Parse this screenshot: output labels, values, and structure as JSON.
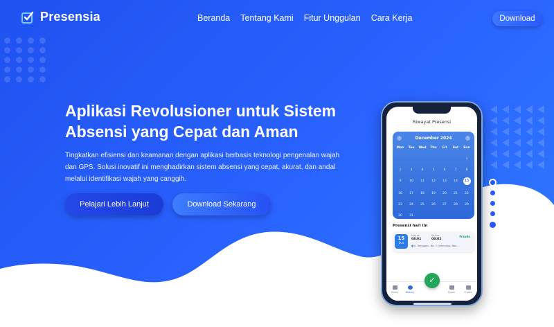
{
  "nav": {
    "logo_text": "Presensia",
    "items": [
      {
        "label": "Beranda"
      },
      {
        "label": "Tentang Kami"
      },
      {
        "label": "Fitur Unggulan"
      },
      {
        "label": "Cara Kerja"
      }
    ],
    "download_label": "Download"
  },
  "hero": {
    "title_line1": "Aplikasi Revolusioner untuk Sistem",
    "title_line2": "Absensi yang Cepat dan Aman",
    "description": "Tingkatkan efisiensi dan keamanan dengan aplikasi berbasis teknologi pengenalan wajah dan GPS. Solusi inovatif ini menghadirkan sistem absensi yang cepat, akurat, dan andal melalui identifikasi wajah yang canggih.",
    "btn_learn": "Pelajari Lebih Lanjut",
    "btn_download": "Download Sekarang"
  },
  "phone": {
    "screen_title": "Riwayat Presensi",
    "calendar": {
      "month": "December 2024",
      "weekdays": [
        "Mon",
        "Tue",
        "Wed",
        "Thu",
        "Fri",
        "Sat",
        "Sun"
      ],
      "days": [
        "",
        "",
        "",
        "",
        "",
        "",
        "1",
        "2",
        "3",
        "4",
        "5",
        "6",
        "7",
        "8",
        "9",
        "10",
        "11",
        "12",
        "13",
        "14",
        "15",
        "16",
        "17",
        "18",
        "19",
        "20",
        "21",
        "22",
        "23",
        "24",
        "25",
        "26",
        "27",
        "28",
        "29",
        "30",
        "31",
        "",
        "",
        "",
        "",
        ""
      ],
      "today": "15"
    },
    "section_label": "Presensi hari ini",
    "card": {
      "day": "15",
      "weekday": "Sun",
      "in_label": "Masuk",
      "in_time": "08:01",
      "out_label": "Keluar",
      "out_time": "08:02",
      "status": "Fraudo",
      "location": "Jl. Senggani, No. 7, Jatimulyo, Bau..."
    },
    "tabs": [
      {
        "label": "Home",
        "icon": "home-icon"
      },
      {
        "label": "History",
        "icon": "history-icon"
      },
      {
        "label": "Pesan",
        "icon": "mail-icon"
      },
      {
        "label": "Profile",
        "icon": "user-icon"
      }
    ],
    "fab_icon": "check-icon"
  },
  "colors": {
    "bg_start": "#1f52f0",
    "bg_end": "#2f7bff",
    "accent": "#2b59ff",
    "success": "#23a55a"
  }
}
